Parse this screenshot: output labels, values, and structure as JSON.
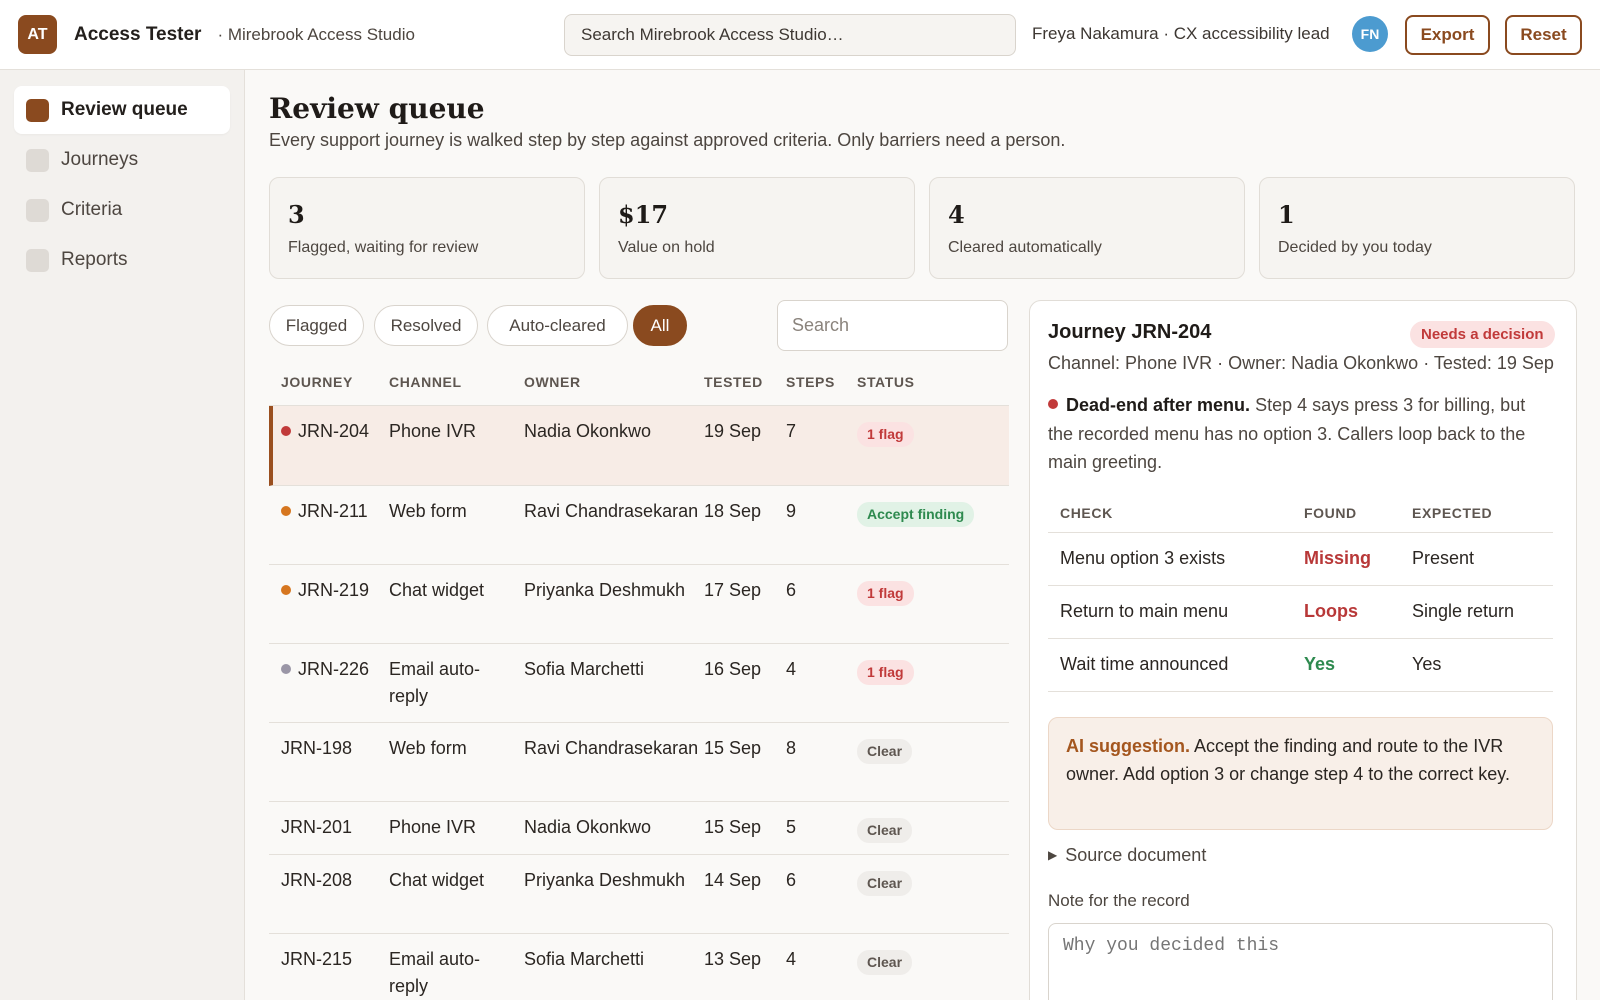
{
  "header": {
    "logo_text": "AT",
    "app_name": "Access Tester",
    "workspace": "· Mirebrook Access Studio",
    "search_placeholder": "Search Mirebrook Access Studio…",
    "user": "Freya Nakamura · CX accessibility lead",
    "avatar_initials": "FN",
    "avatar_color": "#4c9bd0",
    "export_label": "Export",
    "reset_label": "Reset"
  },
  "sidebar": {
    "items": [
      {
        "label": "Review queue",
        "active": true
      },
      {
        "label": "Journeys",
        "active": false
      },
      {
        "label": "Criteria",
        "active": false
      },
      {
        "label": "Reports",
        "active": false
      }
    ]
  },
  "page": {
    "title": "Review queue",
    "subtitle": "Every support journey is walked step by step against approved criteria. Only barriers need a person."
  },
  "stats": [
    {
      "value": "3",
      "label": "Flagged, waiting for review"
    },
    {
      "value": "$17",
      "label": "Value on hold"
    },
    {
      "value": "4",
      "label": "Cleared automatically"
    },
    {
      "value": "1",
      "label": "Decided by you today"
    }
  ],
  "filters": {
    "chips": [
      "Flagged",
      "Resolved",
      "Auto-cleared",
      "All"
    ],
    "active": "All",
    "search_placeholder": "Search"
  },
  "table": {
    "headers": [
      "JOURNEY",
      "CHANNEL",
      "OWNER",
      "TESTED",
      "STEPS",
      "STATUS"
    ],
    "rows": [
      {
        "journey": "JRN-204",
        "channel": "Phone IVR",
        "owner": "Nadia Okonkwo",
        "tested": "19 Sep",
        "steps": "7",
        "status": "1 flag",
        "status_kind": "flag",
        "dot": "#c13a3a",
        "selected": true
      },
      {
        "journey": "JRN-211",
        "channel": "Web form",
        "owner": "Ravi Chandrasekaran",
        "tested": "18 Sep",
        "steps": "9",
        "status": "Accept finding",
        "status_kind": "accept",
        "dot": "#d6761f",
        "selected": false
      },
      {
        "journey": "JRN-219",
        "channel": "Chat widget",
        "owner": "Priyanka Deshmukh",
        "tested": "17 Sep",
        "steps": "6",
        "status": "1 flag",
        "status_kind": "flag",
        "dot": "#d6761f",
        "selected": false
      },
      {
        "journey": "JRN-226",
        "channel": "Email auto-reply",
        "owner": "Sofia Marchetti",
        "tested": "16 Sep",
        "steps": "4",
        "status": "1 flag",
        "status_kind": "flag",
        "dot": "#9a96a6",
        "selected": false
      },
      {
        "journey": "JRN-198",
        "channel": "Web form",
        "owner": "Ravi Chandrasekaran",
        "tested": "15 Sep",
        "steps": "8",
        "status": "Clear",
        "status_kind": "clear",
        "dot": null,
        "selected": false
      },
      {
        "journey": "JRN-201",
        "channel": "Phone IVR",
        "owner": "Nadia Okonkwo",
        "tested": "15 Sep",
        "steps": "5",
        "status": "Clear",
        "status_kind": "clear",
        "dot": null,
        "selected": false
      },
      {
        "journey": "JRN-208",
        "channel": "Chat widget",
        "owner": "Priyanka Deshmukh",
        "tested": "14 Sep",
        "steps": "6",
        "status": "Clear",
        "status_kind": "clear",
        "dot": null,
        "selected": false
      },
      {
        "journey": "JRN-215",
        "channel": "Email auto-reply",
        "owner": "Sofia Marchetti",
        "tested": "13 Sep",
        "steps": "4",
        "status": "Clear",
        "status_kind": "clear",
        "dot": null,
        "selected": false
      }
    ]
  },
  "detail": {
    "title": "Journey JRN-204",
    "badge": "Needs a decision",
    "meta": "Channel: Phone IVR · Owner: Nadia Okonkwo · Tested: 19 Sep",
    "finding_title": "Dead-end after menu.",
    "finding_text": "Step 4 says press 3 for billing, but the recorded menu has no option 3. Callers loop back to the main greeting.",
    "checks_headers": [
      "CHECK",
      "FOUND",
      "EXPECTED"
    ],
    "checks": [
      {
        "check": "Menu option 3 exists",
        "found": "Missing",
        "expected": "Present",
        "ok": false
      },
      {
        "check": "Return to main menu",
        "found": "Loops",
        "expected": "Single return",
        "ok": false
      },
      {
        "check": "Wait time announced",
        "found": "Yes",
        "expected": "Yes",
        "ok": true
      }
    ],
    "ai_label": "AI suggestion.",
    "ai_text": "Accept the finding and route to the IVR owner. Add option 3 or change step 4 to the correct key.",
    "source_label": "Source document",
    "note_label": "Note for the record",
    "note_placeholder": "Why you decided this"
  }
}
